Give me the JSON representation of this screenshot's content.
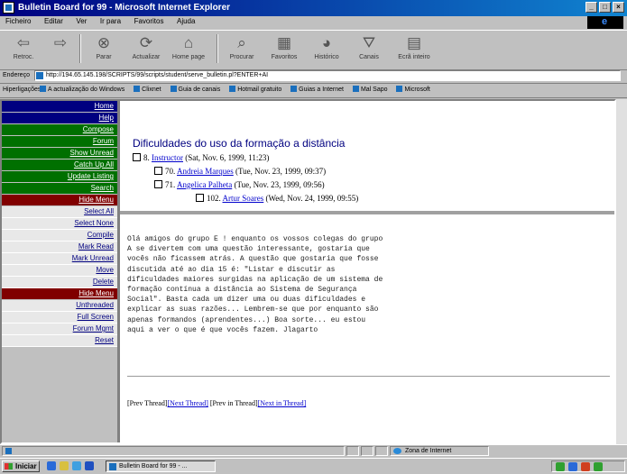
{
  "window": {
    "title": "Bulletin Board for 99 - Microsoft Internet Explorer"
  },
  "menu": [
    "Ficheiro",
    "Editar",
    "Ver",
    "Ir para",
    "Favoritos",
    "Ajuda"
  ],
  "toolbar": [
    {
      "label": "Retroc.",
      "icon": "back-arrow-icon"
    },
    {
      "label": "",
      "icon": "forward-arrow-icon"
    },
    {
      "label": "Parar",
      "icon": "stop-icon"
    },
    {
      "label": "Actualizar",
      "icon": "refresh-icon"
    },
    {
      "label": "Home page",
      "icon": "home-icon"
    },
    {
      "label": "Procurar",
      "icon": "search-icon"
    },
    {
      "label": "Favoritos",
      "icon": "favorites-icon"
    },
    {
      "label": "Histórico",
      "icon": "history-icon"
    },
    {
      "label": "Canais",
      "icon": "channels-icon"
    },
    {
      "label": "Ecrã inteiro",
      "icon": "fullscreen-icon"
    }
  ],
  "address": {
    "label": "Endereço",
    "url": "http://194.65.145.198/SCRIPTS/99/scripts/student/serve_bulletin.pl?ENTER+AI"
  },
  "links": {
    "label": "Hiperligações",
    "items": [
      "A actualização do Windows",
      "Clixnet",
      "Guia de canais",
      "Hotmail gratuito",
      "Guias a Internet",
      "Mal Sapo",
      "Microsoft"
    ]
  },
  "nav": {
    "top": [
      "Home",
      "Help"
    ],
    "green": [
      "Compose",
      "Forum",
      "Show Unread",
      "Catch Up All",
      "Update Listing",
      "Search"
    ],
    "hide1": "Hide Menu",
    "mid": [
      "Select All",
      "Select None",
      "Compile",
      "Mark Read",
      "Mark Unread",
      "Move",
      "Delete"
    ],
    "hide2": "Hide Menu",
    "bottom": [
      "Unthreaded",
      "Full Screen",
      "Forum Mgmt",
      "Reset"
    ]
  },
  "thread": {
    "title": "Dificuldades do uso da formação a distância",
    "posts": [
      {
        "num": "8.",
        "author": "Instructor",
        "date": "(Sat, Nov. 6, 1999, 11:23)"
      },
      {
        "num": "70.",
        "author": "Andreia Marques",
        "date": "(Tue, Nov. 23, 1999, 09:37)"
      },
      {
        "num": "71.",
        "author": "Angelica Palheta",
        "date": "(Tue, Nov. 23, 1999, 09:56)"
      },
      {
        "num": "102.",
        "author": "Artur Soares",
        "date": "(Wed, Nov. 24, 1999, 09:55)"
      }
    ]
  },
  "message": {
    "lines": [
      "Olá amigos do grupo E ! enquanto os vossos colegas do grupo",
      "A se divertem com uma questão interessante, gostaria que",
      "vocês não ficassem atrás. A questão que gostaria que fosse",
      "discutida até ao dia 15 é: \"Listar e discutir as",
      "dificuldades maiores surgidas na aplicação de um sistema de",
      "formação contínua a distância ao Sistema de Segurança",
      "Social\". Basta cada um dizer uma ou duas dificuldades e",
      "explicar as suas razões... Lembrem-se que por enquanto são",
      "apenas formandos (aprendentes...) Boa sorte... eu estou",
      "aqui a ver o que é que vocês fazem. Jlagarto"
    ]
  },
  "thread_nav": {
    "prev_thread": "[Prev Thread]",
    "next_thread": "[Next Thread]",
    "prev_in_thread": "[Prev in Thread]",
    "next_in_thread": "[Next in Thread]"
  },
  "status": {
    "zone": "Zona de Internet"
  },
  "taskbar": {
    "start": "Iniciar",
    "task": "Bulletin Board for 99 - ..."
  }
}
